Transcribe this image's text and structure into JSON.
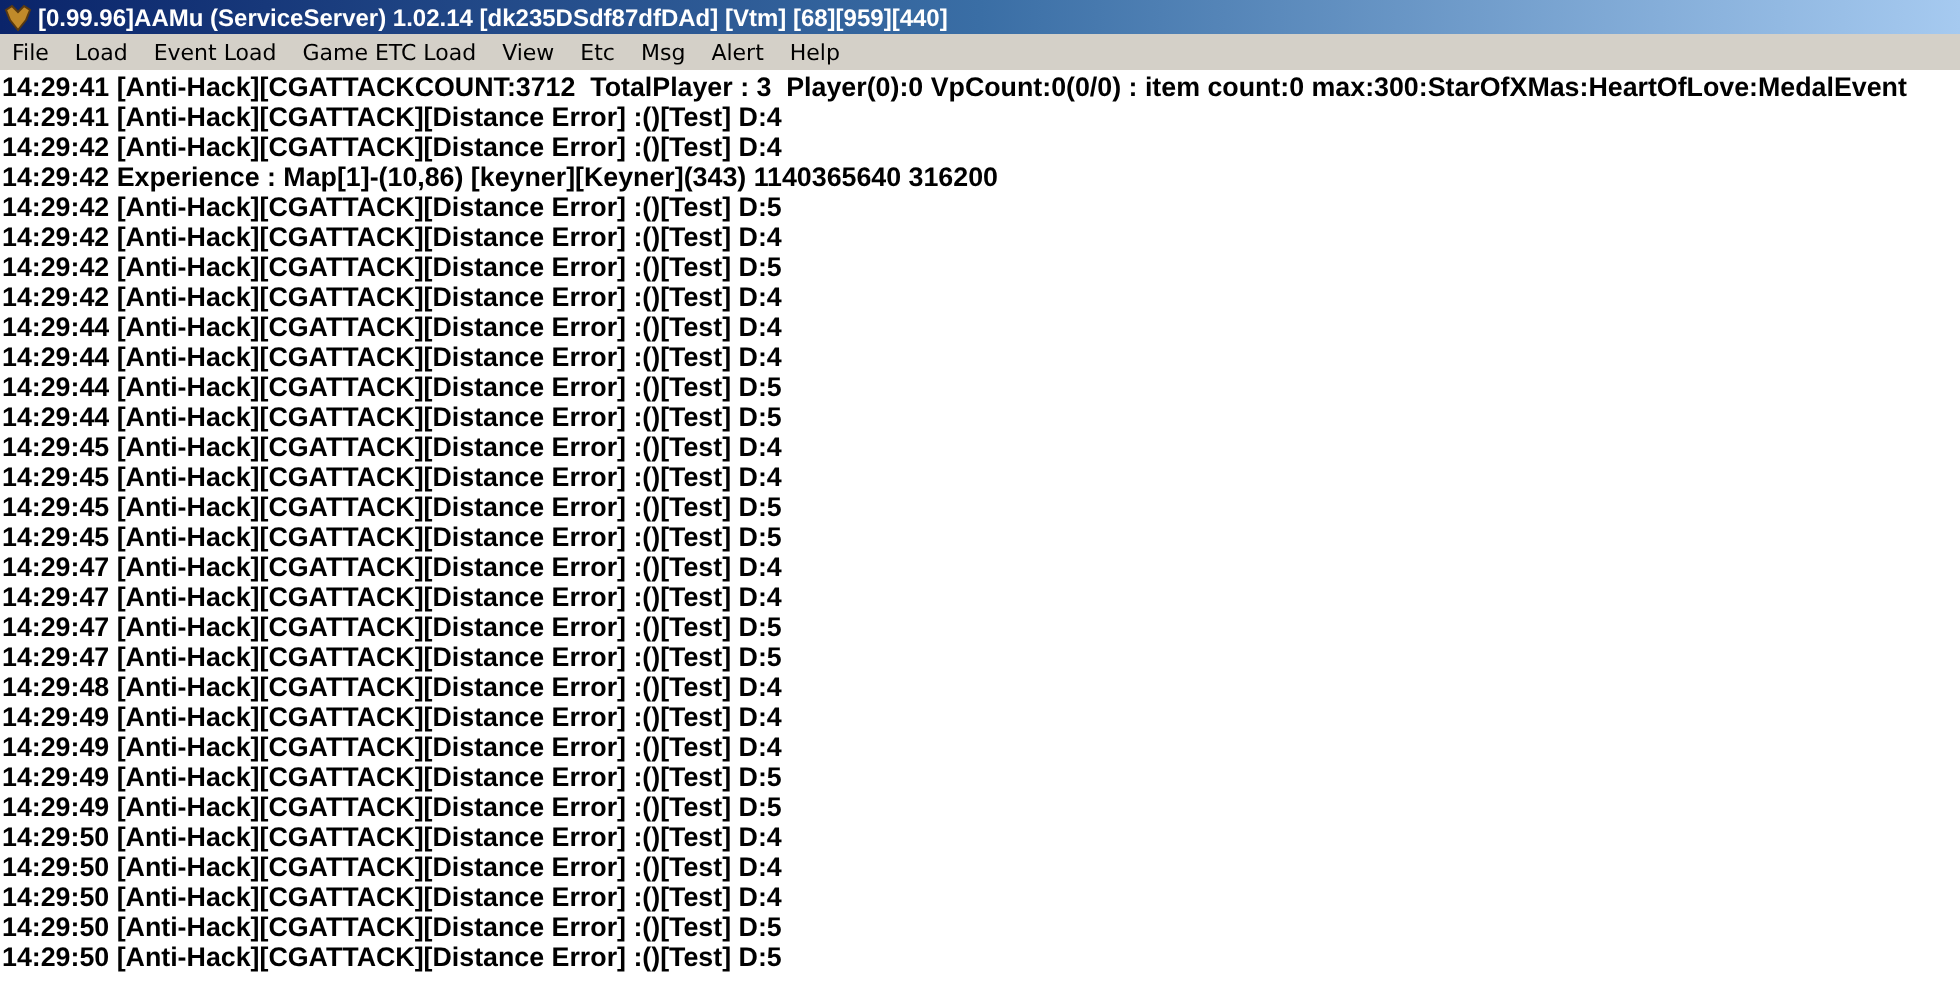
{
  "window": {
    "title": "[0.99.96]AAMu (ServiceServer) 1.02.14 [dk235DSdf87dfDAd] [Vtm] [68][959][440]"
  },
  "menu": [
    "File",
    "Load",
    "Event Load",
    "Game ETC Load",
    "View",
    "Etc",
    "Msg",
    "Alert",
    "Help"
  ],
  "log": [
    "14:29:41 [Anti-Hack][CGATTACKCOUNT:3712  TotalPlayer : 3  Player(0):0 VpCount:0(0/0) : item count:0 max:300:StarOfXMas:HeartOfLove:MedalEvent",
    "14:29:41 [Anti-Hack][CGATTACK][Distance Error] :()[Test] D:4",
    "14:29:42 [Anti-Hack][CGATTACK][Distance Error] :()[Test] D:4",
    "14:29:42 Experience : Map[1]-(10,86) [keyner][Keyner](343) 1140365640 316200",
    "14:29:42 [Anti-Hack][CGATTACK][Distance Error] :()[Test] D:5",
    "14:29:42 [Anti-Hack][CGATTACK][Distance Error] :()[Test] D:4",
    "14:29:42 [Anti-Hack][CGATTACK][Distance Error] :()[Test] D:5",
    "14:29:42 [Anti-Hack][CGATTACK][Distance Error] :()[Test] D:4",
    "14:29:44 [Anti-Hack][CGATTACK][Distance Error] :()[Test] D:4",
    "14:29:44 [Anti-Hack][CGATTACK][Distance Error] :()[Test] D:4",
    "14:29:44 [Anti-Hack][CGATTACK][Distance Error] :()[Test] D:5",
    "14:29:44 [Anti-Hack][CGATTACK][Distance Error] :()[Test] D:5",
    "14:29:45 [Anti-Hack][CGATTACK][Distance Error] :()[Test] D:4",
    "14:29:45 [Anti-Hack][CGATTACK][Distance Error] :()[Test] D:4",
    "14:29:45 [Anti-Hack][CGATTACK][Distance Error] :()[Test] D:5",
    "14:29:45 [Anti-Hack][CGATTACK][Distance Error] :()[Test] D:5",
    "14:29:47 [Anti-Hack][CGATTACK][Distance Error] :()[Test] D:4",
    "14:29:47 [Anti-Hack][CGATTACK][Distance Error] :()[Test] D:4",
    "14:29:47 [Anti-Hack][CGATTACK][Distance Error] :()[Test] D:5",
    "14:29:47 [Anti-Hack][CGATTACK][Distance Error] :()[Test] D:5",
    "14:29:48 [Anti-Hack][CGATTACK][Distance Error] :()[Test] D:4",
    "14:29:49 [Anti-Hack][CGATTACK][Distance Error] :()[Test] D:4",
    "14:29:49 [Anti-Hack][CGATTACK][Distance Error] :()[Test] D:4",
    "14:29:49 [Anti-Hack][CGATTACK][Distance Error] :()[Test] D:5",
    "14:29:49 [Anti-Hack][CGATTACK][Distance Error] :()[Test] D:5",
    "14:29:50 [Anti-Hack][CGATTACK][Distance Error] :()[Test] D:4",
    "14:29:50 [Anti-Hack][CGATTACK][Distance Error] :()[Test] D:4",
    "14:29:50 [Anti-Hack][CGATTACK][Distance Error] :()[Test] D:4",
    "14:29:50 [Anti-Hack][CGATTACK][Distance Error] :()[Test] D:5",
    "14:29:50 [Anti-Hack][CGATTACK][Distance Error] :()[Test] D:5"
  ]
}
